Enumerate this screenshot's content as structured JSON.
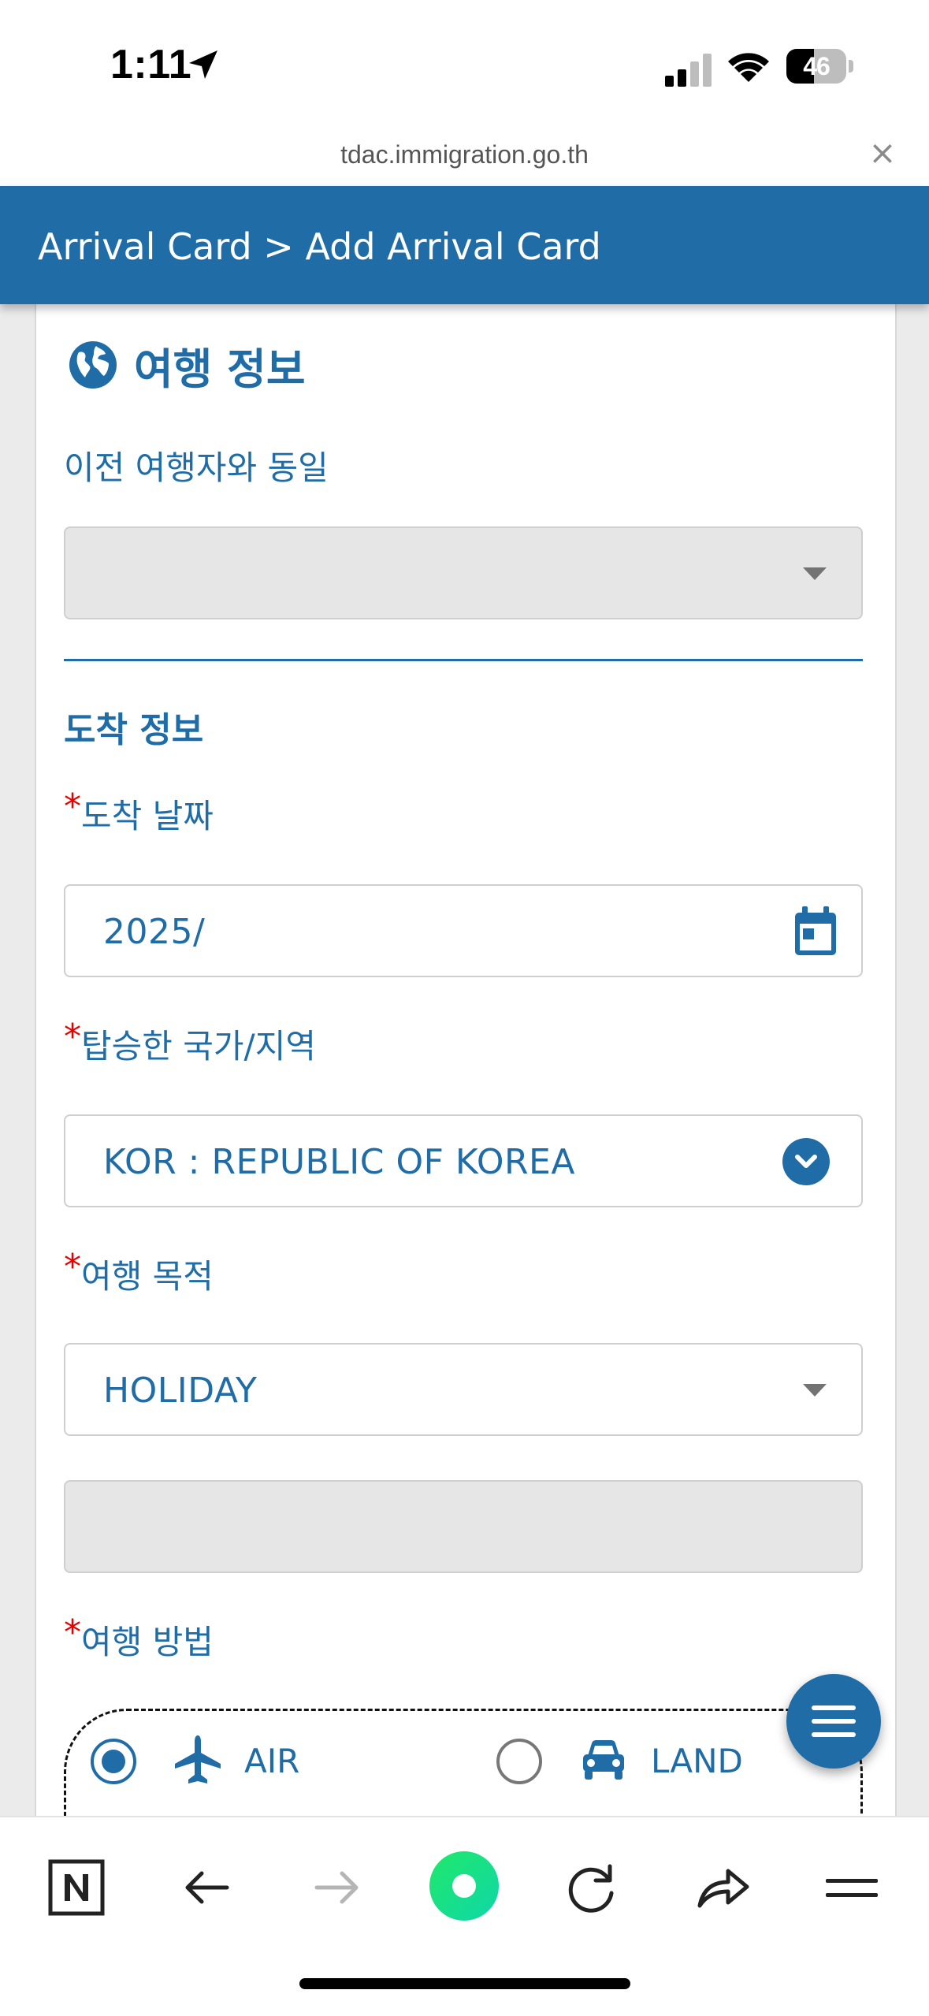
{
  "status_bar": {
    "time": "1:11",
    "battery_level": "46",
    "battery_fraction": 0.46,
    "signal_bars_active": 2,
    "signal_bars_total": 4
  },
  "browser": {
    "url": "tdac.immigration.go.th",
    "close_glyph": "×"
  },
  "header": {
    "title": "Arrival Card > Add Arrival Card"
  },
  "travel_info": {
    "section_title": "여행 정보",
    "section_icon": "globe-icon",
    "same_as_previous_label": "이전 여행자와 동일",
    "same_as_previous_value": "",
    "subsection_title": "도착 정보",
    "required_marker": "*",
    "arrival_date": {
      "label": "도착 날짜",
      "value": "2025/",
      "icon": "calendar-icon"
    },
    "boarding_country": {
      "label": "탑승한 국가/지역",
      "value": "KOR : REPUBLIC OF KOREA",
      "icon": "chevron-down-circle-icon"
    },
    "trip_purpose": {
      "label": "여행 목적",
      "value": "HOLIDAY",
      "other_value": ""
    },
    "travel_mode": {
      "label": "여행 방법",
      "options": [
        {
          "label": "AIR",
          "icon": "airplane-icon",
          "selected": true
        },
        {
          "label": "LAND",
          "icon": "car-icon",
          "selected": false
        }
      ]
    }
  },
  "fab": {
    "icon": "menu-icon"
  },
  "bottom_bar": {
    "icons": [
      "naver-n-icon",
      "back-arrow-icon",
      "forward-arrow-icon",
      "green-dot-icon",
      "reload-icon",
      "share-icon",
      "menu-lines-icon"
    ]
  },
  "colors": {
    "brand_blue": "#1f6ca6",
    "required_red": "#e60000",
    "disabled_field": "#e6e6e6",
    "green_accent": "#14e07a"
  }
}
